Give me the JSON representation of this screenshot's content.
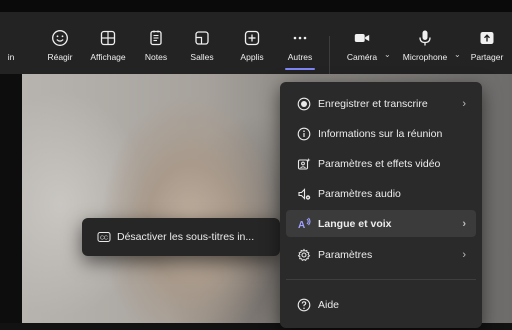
{
  "toolbar": {
    "items": [
      {
        "label": "in",
        "icon": "partial-item-icon"
      },
      {
        "label": "Réagir",
        "icon": "smiley-icon"
      },
      {
        "label": "Affichage",
        "icon": "grid-view-icon"
      },
      {
        "label": "Notes",
        "icon": "notes-icon"
      },
      {
        "label": "Salles",
        "icon": "rooms-icon"
      },
      {
        "label": "Applis",
        "icon": "add-app-icon"
      },
      {
        "label": "Autres",
        "icon": "more-icon"
      },
      {
        "label": "Caméra",
        "icon": "camera-icon"
      },
      {
        "label": "Microphone",
        "icon": "microphone-icon"
      },
      {
        "label": "Partager",
        "icon": "share-icon"
      }
    ],
    "active_item": "Autres",
    "accent_color": "#7f85f5"
  },
  "menu": {
    "items": [
      {
        "label": "Enregistrer et transcrire",
        "icon": "record-icon",
        "has_submenu": true
      },
      {
        "label": "Informations sur la réunion",
        "icon": "info-icon",
        "has_submenu": false
      },
      {
        "label": "Paramètres et effets vidéo",
        "icon": "video-effects-icon",
        "has_submenu": false
      },
      {
        "label": "Paramètres audio",
        "icon": "audio-settings-icon",
        "has_submenu": false
      },
      {
        "label": "Langue et voix",
        "icon": "language-voice-icon",
        "has_submenu": true
      },
      {
        "label": "Paramètres",
        "icon": "settings-icon",
        "has_submenu": true
      },
      {
        "label": "Aide",
        "icon": "help-icon",
        "has_submenu": false
      }
    ],
    "highlighted_item": "Langue et voix"
  },
  "submenu": {
    "items": [
      {
        "label": "Désactiver les sous-titres in...",
        "icon": "closed-caption-icon"
      }
    ]
  }
}
